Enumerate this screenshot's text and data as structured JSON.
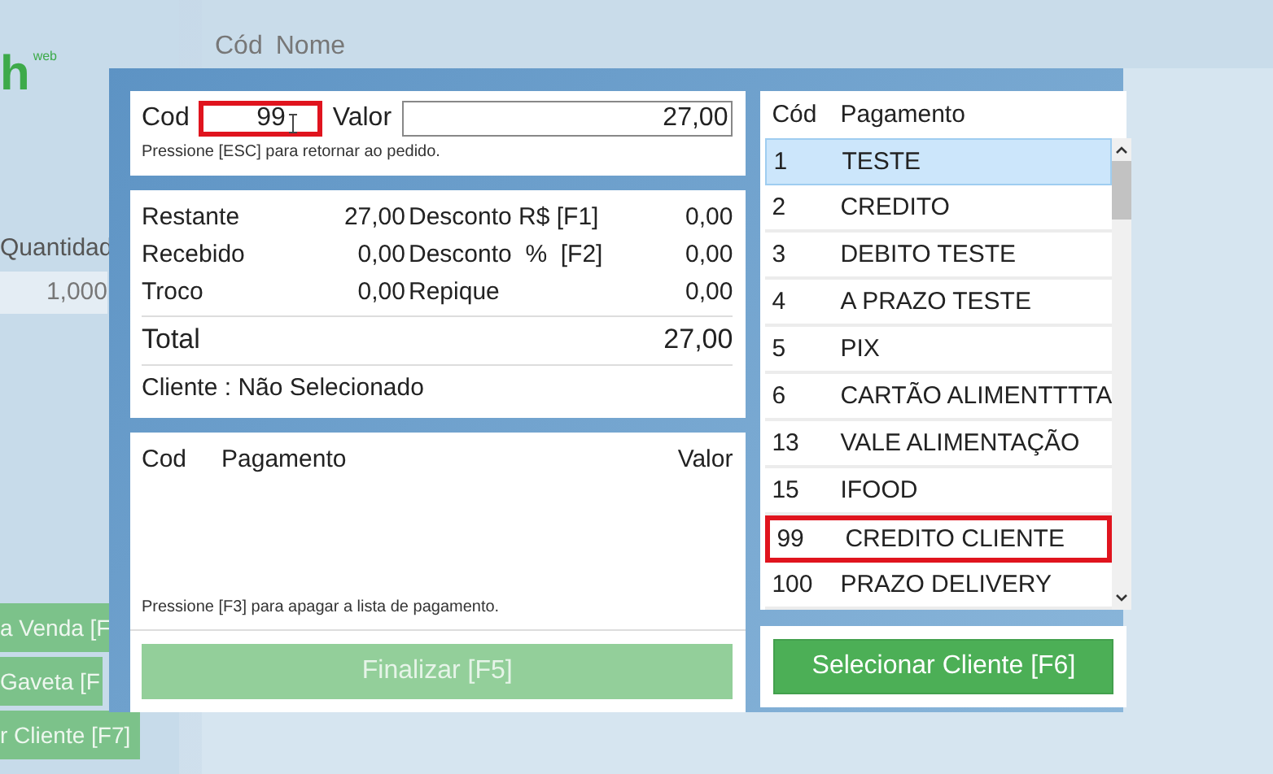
{
  "background": {
    "logo": "h",
    "logo_sup": "web",
    "header_columns": [
      "Cód",
      "Nome"
    ],
    "quantity_label": "Quantidad",
    "quantity_value": "1,000",
    "side_buttons": [
      "a Venda [F",
      "Gaveta [F",
      "r Cliente [F7]"
    ]
  },
  "dialog": {
    "code_field": {
      "label": "Cod",
      "value": "99",
      "highlighted": true
    },
    "value_field": {
      "label": "Valor",
      "value": "27,00"
    },
    "esc_hint": "Pressione [ESC] para retornar ao pedido.",
    "summary": [
      {
        "label": "Restante",
        "amount": "27,00",
        "discount_label": "Desconto R$ [F1]",
        "discount_amount": "0,00"
      },
      {
        "label": "Recebido",
        "amount": "0,00",
        "discount_label": "Desconto  %  [F2]",
        "discount_amount": "0,00"
      },
      {
        "label": "Troco",
        "amount": "0,00",
        "discount_label": "Repique",
        "discount_amount": "0,00"
      }
    ],
    "total": {
      "label": "Total",
      "value": "27,00"
    },
    "client": "Cliente : Não Selecionado",
    "payments_table": {
      "columns": [
        "Cod",
        "Pagamento",
        "Valor"
      ],
      "hint": "Pressione [F3] para apagar a lista de pagamento."
    },
    "finalize_button": {
      "label": "Finalizar [F5]",
      "disabled": true
    },
    "methods": {
      "columns": [
        "Cód",
        "Pagamento"
      ],
      "rows": [
        {
          "code": "1",
          "name": "TESTE",
          "selected": true,
          "highlighted": false
        },
        {
          "code": "2",
          "name": "CREDITO",
          "selected": false,
          "highlighted": false
        },
        {
          "code": "3",
          "name": "DEBITO TESTE",
          "selected": false,
          "highlighted": false
        },
        {
          "code": "4",
          "name": "A PRAZO TESTE",
          "selected": false,
          "highlighted": false
        },
        {
          "code": "5",
          "name": "PIX",
          "selected": false,
          "highlighted": false
        },
        {
          "code": "6",
          "name": "CARTÃO ALIMENTTTTA",
          "selected": false,
          "highlighted": false
        },
        {
          "code": "13",
          "name": "VALE ALIMENTAÇÃO",
          "selected": false,
          "highlighted": false
        },
        {
          "code": "15",
          "name": "IFOOD",
          "selected": false,
          "highlighted": false
        },
        {
          "code": "99",
          "name": "CREDITO CLIENTE",
          "selected": false,
          "highlighted": true
        },
        {
          "code": "100",
          "name": "PRAZO DELIVERY",
          "selected": false,
          "highlighted": false
        }
      ]
    },
    "client_button": {
      "label": "Selecionar Cliente [F6]",
      "disabled": false
    }
  }
}
